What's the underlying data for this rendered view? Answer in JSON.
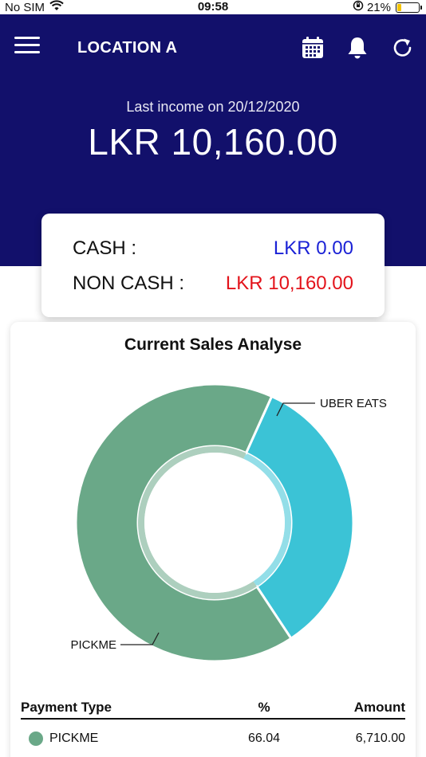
{
  "status_bar": {
    "carrier": "No SIM",
    "time": "09:58",
    "battery": "21%",
    "battery_level": 0.21
  },
  "header": {
    "location": "LOCATION A",
    "last_income_label": "Last income on 20/12/2020",
    "total_amount": "LKR 10,160.00",
    "icons": [
      "menu-icon",
      "calendar-icon",
      "bell-icon",
      "refresh-icon"
    ]
  },
  "cash_summary": {
    "cash_label": "CASH :",
    "cash_value": "LKR 0.00",
    "non_cash_label": "NON CASH :",
    "non_cash_value": "LKR 10,160.00"
  },
  "analysis": {
    "title": "Current Sales Analyse"
  },
  "chart_data": {
    "type": "pie",
    "title": "Current Sales Analyse",
    "labels": [
      "UBER EATS",
      "PICKME"
    ],
    "values": [
      33.96,
      66.04
    ],
    "colors": [
      "#3bc3d6",
      "#6aa888"
    ],
    "donut": true
  },
  "table": {
    "headers": [
      "Payment Type",
      "%",
      "Amount"
    ],
    "rows": [
      {
        "type": "PICKME",
        "percent": "66.04",
        "amount": "6,710.00",
        "color": "#6aa888"
      }
    ]
  },
  "colors": {
    "header_bg": "#12106b",
    "cash_blue": "#1b22d6",
    "non_cash_red": "#e3131b"
  }
}
